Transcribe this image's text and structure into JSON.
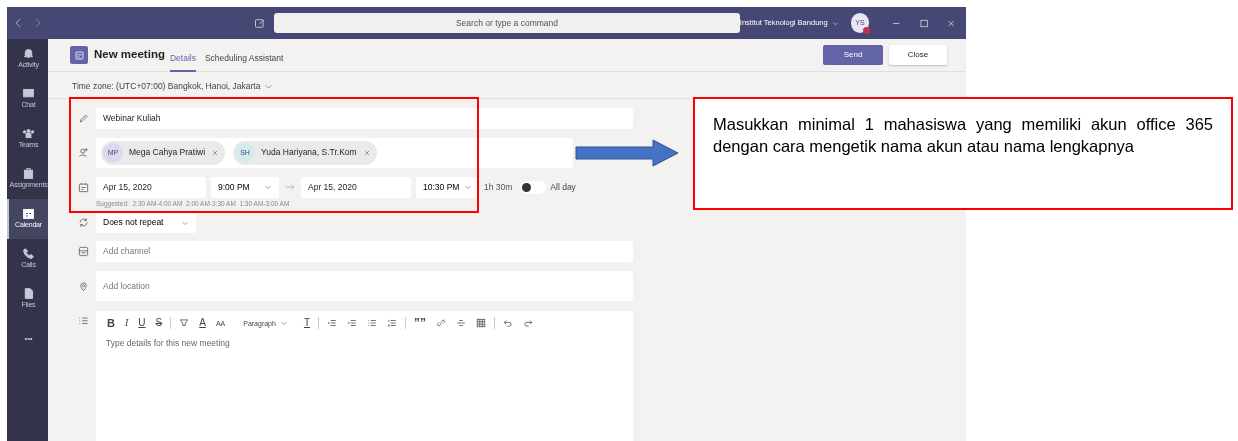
{
  "title_bar": {
    "search_placeholder": "Search or type a command",
    "org": "Institut Teknologi Bandung",
    "avatar": "YS"
  },
  "rail": [
    {
      "label": "Activity",
      "selected": false
    },
    {
      "label": "Chat",
      "selected": false
    },
    {
      "label": "Teams",
      "selected": false
    },
    {
      "label": "Assignments",
      "selected": false
    },
    {
      "label": "Calendar",
      "selected": true
    },
    {
      "label": "Calls",
      "selected": false
    },
    {
      "label": "Files",
      "selected": false
    }
  ],
  "rail_more": "•••",
  "header": {
    "title": "New meeting",
    "tabs": [
      {
        "label": "Details",
        "selected": true
      },
      {
        "label": "Scheduling Assistant",
        "selected": false
      }
    ],
    "buttons": [
      {
        "label": "Send",
        "kind": "primary"
      },
      {
        "label": "Close",
        "kind": "default"
      }
    ]
  },
  "timezone": "Time zone: (UTC+07:00) Bangkok, Hanoi, Jakarta",
  "form": {
    "title": "Webinar Kuliah",
    "attendees": [
      {
        "initials": "MP",
        "name": "Mega Cahya Pratiwi",
        "color": "#dcd9ef"
      },
      {
        "initials": "SH",
        "name": "Yuda Hariyana, S.Tr.Kom",
        "color": "#d2ecee"
      }
    ],
    "start_date": "Apr 15, 2020",
    "start_time": "9:00 PM",
    "end_date": "Apr 15, 2020",
    "end_time": "10:30 PM",
    "duration": "1h 30m",
    "all_day": {
      "label": "All day",
      "on": false
    },
    "suggested": "Suggested:  2:30 AM-4:00 AM  2:00 AM-3:30 AM  1:30 AM-3:00 AM",
    "repeat": "Does not repeat",
    "channel_placeholder": "Add channel",
    "location_placeholder": "Add location",
    "toolbar": {
      "glyphs": [
        "B",
        "I",
        "U",
        "S"
      ],
      "color_glyphs": [
        "A",
        "AA"
      ],
      "paragraph": "Paragraph",
      "quote": "”",
      "clear": "T"
    },
    "details_placeholder": "Type details for this new meeting"
  },
  "annotation": "Masukkan minimal 1 mahasiswa yang memiliki akun office 365 dengan cara mengetik nama akun atau nama lengkapnya"
}
